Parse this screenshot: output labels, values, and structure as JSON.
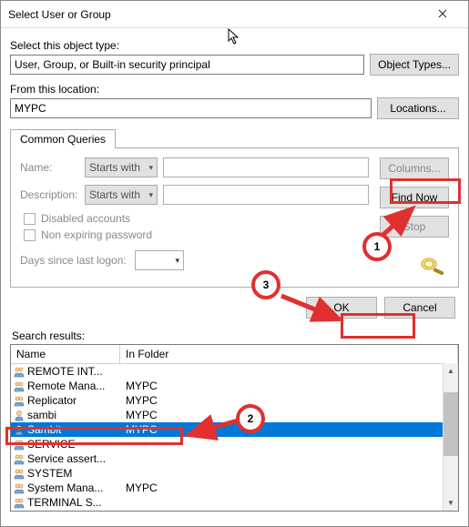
{
  "window": {
    "title": "Select User or Group"
  },
  "object_type": {
    "label": "Select this object type:",
    "value": "User, Group, or Built-in security principal",
    "button": "Object Types..."
  },
  "location": {
    "label": "From this location:",
    "value": "MYPC",
    "button": "Locations..."
  },
  "queries": {
    "tab": "Common Queries",
    "name_label": "Name:",
    "name_mode": "Starts with",
    "desc_label": "Description:",
    "desc_mode": "Starts with",
    "disabled": "Disabled accounts",
    "nonexpire": "Non expiring password",
    "days_label": "Days since last logon:",
    "columns_btn": "Columns...",
    "findnow_btn": "Find Now",
    "stop_btn": "Stop"
  },
  "buttons": {
    "ok": "OK",
    "cancel": "Cancel"
  },
  "search": {
    "label": "Search results:",
    "col_name": "Name",
    "col_folder": "In Folder",
    "rows": [
      {
        "icon": "group",
        "name": "REMOTE INT...",
        "folder": ""
      },
      {
        "icon": "group",
        "name": "Remote Mana...",
        "folder": "MYPC"
      },
      {
        "icon": "group",
        "name": "Replicator",
        "folder": "MYPC"
      },
      {
        "icon": "user",
        "name": "sambi",
        "folder": "MYPC"
      },
      {
        "icon": "user",
        "name": "Sambit",
        "folder": "MYPC",
        "selected": true
      },
      {
        "icon": "group",
        "name": "SERVICE",
        "folder": ""
      },
      {
        "icon": "group",
        "name": "Service assert...",
        "folder": ""
      },
      {
        "icon": "group",
        "name": "SYSTEM",
        "folder": ""
      },
      {
        "icon": "group",
        "name": "System Mana...",
        "folder": "MYPC"
      },
      {
        "icon": "group",
        "name": "TERMINAL S...",
        "folder": ""
      }
    ]
  },
  "annotations": {
    "step1": "1",
    "step2": "2",
    "step3": "3"
  }
}
